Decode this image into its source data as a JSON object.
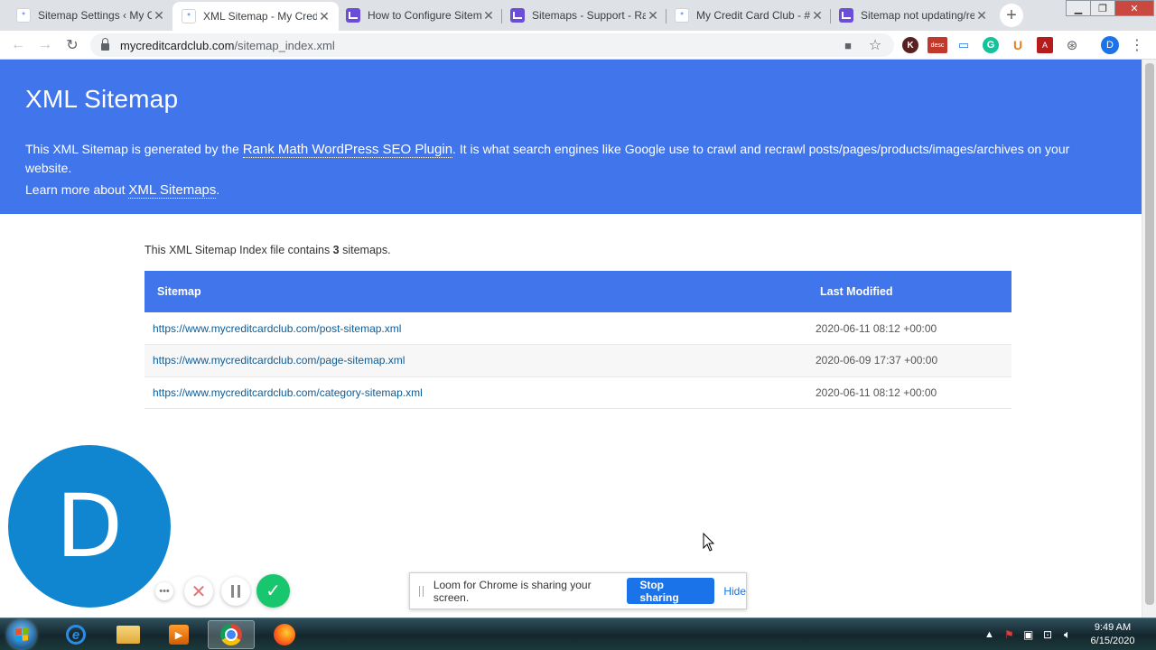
{
  "browser": {
    "tabs": [
      {
        "title": "Sitemap Settings ‹ My Cr",
        "icon": "wordpress-icon",
        "active": false
      },
      {
        "title": "XML Sitemap - My Credit",
        "icon": "wordpress-icon",
        "active": true
      },
      {
        "title": "How to Configure Sitem",
        "icon": "rankmath-icon",
        "active": false
      },
      {
        "title": "Sitemaps - Support - Ra",
        "icon": "rankmath-icon",
        "active": false
      },
      {
        "title": "My Credit Card Club - #",
        "icon": "wordpress-icon",
        "active": false
      },
      {
        "title": "Sitemap not updating/re",
        "icon": "rankmath-icon",
        "active": false
      }
    ],
    "url_host": "mycreditcardclub.com",
    "url_path": "/sitemap_index.xml",
    "profile_initial": "D",
    "extensions": [
      "K",
      "desc",
      "U"
    ]
  },
  "page": {
    "title": "XML Sitemap",
    "intro_before": "This XML Sitemap is generated by the ",
    "intro_link": "Rank Math WordPress SEO Plugin",
    "intro_after": ". It is what search engines like Google use to crawl and recrawl posts/pages/products/images/archives on your website.",
    "learn_before": "Learn more about ",
    "learn_link": "XML Sitemaps",
    "learn_after": ".",
    "summary_before": "This XML Sitemap Index file contains ",
    "summary_count": "3",
    "summary_after": " sitemaps.",
    "columns": [
      "Sitemap",
      "Last Modified"
    ],
    "rows": [
      {
        "url": "https://www.mycreditcardclub.com/post-sitemap.xml",
        "modified": "2020-06-11 08:12 +00:00"
      },
      {
        "url": "https://www.mycreditcardclub.com/page-sitemap.xml",
        "modified": "2020-06-09 17:37 +00:00"
      },
      {
        "url": "https://www.mycreditcardclub.com/category-sitemap.xml",
        "modified": "2020-06-11 08:12 +00:00"
      }
    ],
    "accent_color": "#4175eb"
  },
  "loom": {
    "avatar_initial": "D",
    "share_message": "Loom for Chrome is sharing your screen.",
    "stop_label": "Stop sharing",
    "hide_label": "Hide"
  },
  "taskbar": {
    "time": "9:49 AM",
    "date": "6/15/2020"
  }
}
